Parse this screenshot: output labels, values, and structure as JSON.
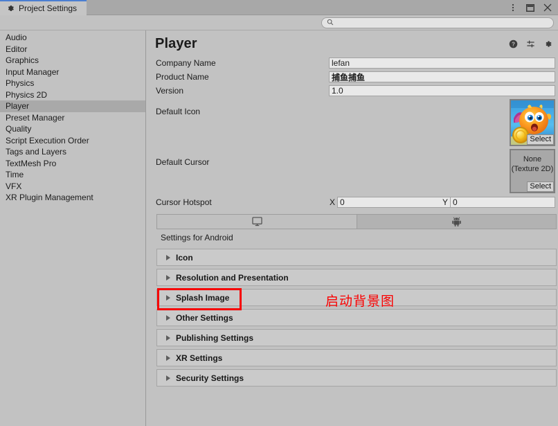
{
  "window": {
    "tab_label": "Project Settings",
    "tab_icon": "gear-icon",
    "controls": [
      {
        "name": "more-options-icon",
        "glyph": "⋮"
      },
      {
        "name": "maximize-icon",
        "glyph": "▭"
      },
      {
        "name": "close-icon",
        "glyph": "✕"
      }
    ]
  },
  "search": {
    "value": "",
    "placeholder": "",
    "icon": "search-icon"
  },
  "sidebar": {
    "items": [
      {
        "label": "Audio",
        "selected": false
      },
      {
        "label": "Editor",
        "selected": false
      },
      {
        "label": "Graphics",
        "selected": false
      },
      {
        "label": "Input Manager",
        "selected": false
      },
      {
        "label": "Physics",
        "selected": false
      },
      {
        "label": "Physics 2D",
        "selected": false
      },
      {
        "label": "Player",
        "selected": true
      },
      {
        "label": "Preset Manager",
        "selected": false
      },
      {
        "label": "Quality",
        "selected": false
      },
      {
        "label": "Script Execution Order",
        "selected": false
      },
      {
        "label": "Tags and Layers",
        "selected": false
      },
      {
        "label": "TextMesh Pro",
        "selected": false
      },
      {
        "label": "Time",
        "selected": false
      },
      {
        "label": "VFX",
        "selected": false
      },
      {
        "label": "XR Plugin Management",
        "selected": false
      }
    ]
  },
  "main": {
    "title": "Player",
    "header_icons": [
      {
        "name": "help-icon"
      },
      {
        "name": "preset-icon"
      },
      {
        "name": "settings-gear-icon"
      }
    ],
    "fields": [
      {
        "label": "Company Name",
        "value": "lefan",
        "cjk": false
      },
      {
        "label": "Product Name",
        "value": "捕鱼捕鱼",
        "cjk": true
      },
      {
        "label": "Version",
        "value": "1.0",
        "cjk": false
      }
    ],
    "default_icon": {
      "label": "Default Icon",
      "select_label": "Select",
      "has_texture": true
    },
    "default_cursor": {
      "label": "Default Cursor",
      "value_line1": "None",
      "value_line2": "(Texture 2D)",
      "select_label": "Select",
      "has_texture": false
    },
    "cursor_hotspot": {
      "label": "Cursor Hotspot",
      "x_letter": "X",
      "x_value": "0",
      "y_letter": "Y",
      "y_value": "0"
    },
    "platform_tabs": [
      {
        "name": "tab-standalone",
        "icon": "monitor-icon",
        "active": true
      },
      {
        "name": "tab-android",
        "icon": "android-icon",
        "active": false
      }
    ],
    "settings_for": "Settings for Android",
    "sections": [
      {
        "label": "Icon",
        "expanded": false
      },
      {
        "label": "Resolution and Presentation",
        "expanded": false
      },
      {
        "label": "Splash Image",
        "expanded": false,
        "highlighted": true
      },
      {
        "label": "Other Settings",
        "expanded": false
      },
      {
        "label": "Publishing Settings",
        "expanded": false
      },
      {
        "label": "XR Settings",
        "expanded": false
      },
      {
        "label": "Security Settings",
        "expanded": false
      }
    ]
  },
  "annotation": {
    "text": "启动背景图",
    "color": "#fa0000"
  },
  "colors": {
    "window_bg": "#c2c2c2",
    "tabbar_bg": "#a8a8a8",
    "tab_active_bg": "#c5c5c5",
    "tab_accent": "#4b7fd1",
    "selection": "#a9a9a9",
    "input_bg": "#e9e9e9",
    "foldout_bg": "#cacaca",
    "annotation_red": "#fa0000"
  }
}
